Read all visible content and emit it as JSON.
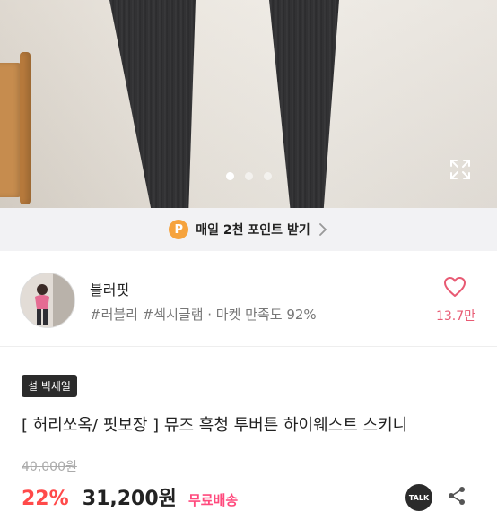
{
  "carousel": {
    "dots": [
      true,
      false,
      false
    ],
    "expand_icon": "expand-icon"
  },
  "banner": {
    "coin_letter": "P",
    "text": "매일 2천 포인트 받기",
    "chevron_icon": "chevron-right-icon"
  },
  "seller": {
    "name": "블러핏",
    "tags": "#러블리 #섹시글램 · 마켓 만족도 92%",
    "like_icon": "heart-icon",
    "like_count": "13.7만"
  },
  "product": {
    "badge": "설 빅세일",
    "title": "[ 허리쏘옥/ 핏보장 ] 뮤즈 흑청 투버튼 하이웨스트 스키니",
    "original_price": "40,000원",
    "discount": "22%",
    "price": "31,200원",
    "shipping": "무료배송",
    "talk_label": "TALK",
    "share_icon": "share-icon"
  },
  "colors": {
    "accent_pink": "#e85a73",
    "discount_red": "#ff4a4a",
    "coin_orange": "#f6a33d"
  }
}
